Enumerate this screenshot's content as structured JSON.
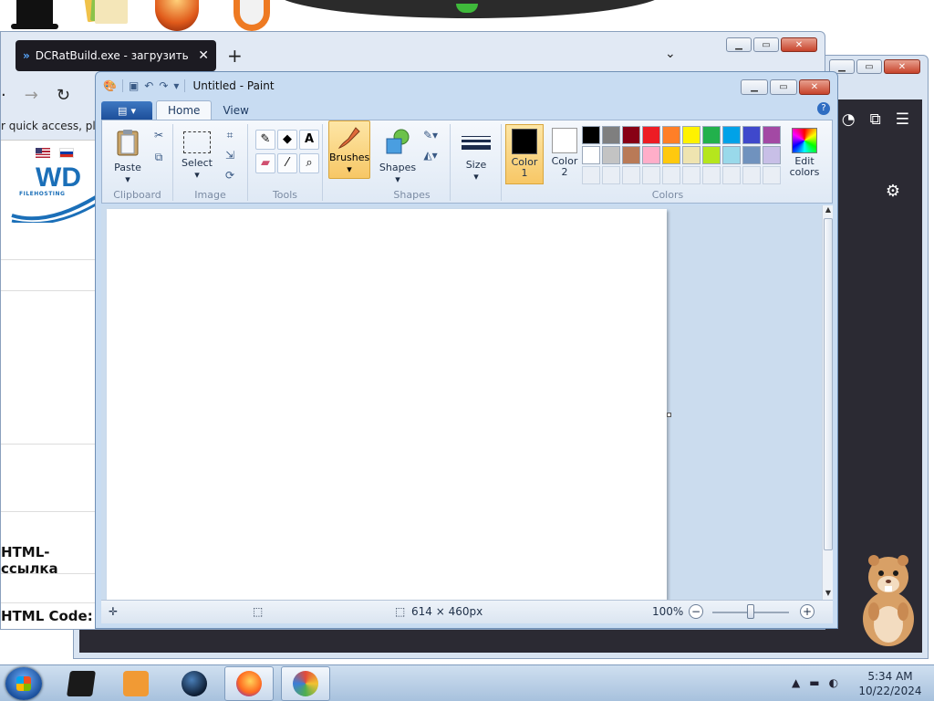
{
  "colors": {
    "accent": "#2e6dc2",
    "tab_bg": "#1c1b22",
    "brushes_highlight": "#f7c766"
  },
  "browser": {
    "tab_title": "DCRatBuild.exe - загрузить фа",
    "new_tab": "+",
    "tab_list": "⌄",
    "quick_access": "r quick access, place",
    "html_link_label": "HTML-ссылка",
    "html_code_label": "HTML Code:",
    "logo_text": "WD",
    "logo_sub": "FILEHOSTING"
  },
  "paint": {
    "title": "Untitled - Paint",
    "tabs": [
      "Home",
      "View"
    ],
    "groups": {
      "clipboard": "Clipboard",
      "image": "Image",
      "tools": "Tools",
      "shapes": "Shapes",
      "colors": "Colors"
    },
    "buttons": {
      "paste": "Paste",
      "select": "Select",
      "brushes": "Brushes",
      "shapes": "Shapes",
      "size": "Size",
      "color1_line1": "Color",
      "color1_line2": "1",
      "color2_line1": "Color",
      "color2_line2": "2",
      "edit_colors_line1": "Edit",
      "edit_colors_line2": "colors"
    },
    "color1": "#000000",
    "color2": "#ffffff",
    "palette": [
      "#000000",
      "#7f7f7f",
      "#880015",
      "#ed1c24",
      "#ff7f27",
      "#fff200",
      "#22b14c",
      "#00a2e8",
      "#3f48cc",
      "#a349a4",
      "#ffffff",
      "#c3c3c3",
      "#b97a57",
      "#ffaec9",
      "#ffc90e",
      "#efe4b0",
      "#b5e61d",
      "#99d9ea",
      "#7092be",
      "#c8bfe7"
    ],
    "status": {
      "canvas_size": "614 × 460px",
      "zoom": "100%"
    }
  },
  "taskbar": {
    "time": "5:34 AM",
    "date": "10/22/2024"
  }
}
